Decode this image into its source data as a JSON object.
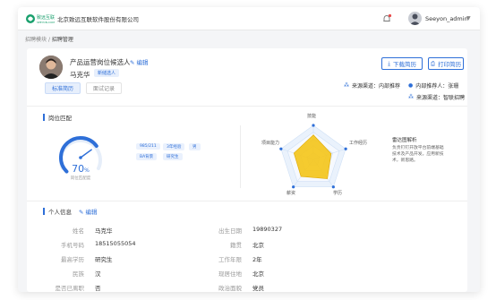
{
  "header": {
    "logo_text": "致远互联",
    "logo_subtext": "SEEYON.COM",
    "company": "北京致远互联软件股份有限公司",
    "username": "Seeyon_admin"
  },
  "breadcrumb": {
    "parent": "招聘模块",
    "separator": "/",
    "current": "招聘管理"
  },
  "candidate": {
    "job_title": "产品运营岗位候选人",
    "edit_label": "编辑",
    "name": "马克华",
    "tag": "新储选人"
  },
  "actions": {
    "download_label": "下载简历",
    "print_label": "打印简历"
  },
  "sources": {
    "row1": [
      {
        "label": "来源渠道：内部推荐"
      },
      {
        "label": "内部推荐人：张珊"
      }
    ],
    "row2": [
      {
        "label": "来源渠道：智联招聘"
      }
    ]
  },
  "tabs": [
    {
      "label": "标准简历",
      "active": true
    },
    {
      "label": "面试记录",
      "active": false
    }
  ],
  "match": {
    "section_title": "岗位匹配",
    "percent": "70",
    "percent_unit": "%",
    "percent_value": 70,
    "percent_label": "岗位匹配度",
    "tags": [
      "985/211",
      "3年经验",
      "男",
      "BA背景",
      "研究生"
    ]
  },
  "radar": {
    "labels": [
      "技能",
      "工作经历",
      "学历",
      "薪资",
      "项目能力"
    ],
    "values": [
      0.72,
      0.55,
      0.7,
      0.62,
      0.6
    ],
    "fill_color": "#f5c518",
    "grid_color": "#cfe0f5"
  },
  "analysis": {
    "title": "雷达图解析",
    "text": "负责钉钉开放平台前端基础技术及产品开发。应用新技术，新思路。"
  },
  "personal": {
    "section_title": "个人信息",
    "edit_label": "编辑",
    "fields_left": [
      {
        "label": "姓名",
        "value": "马克华"
      },
      {
        "label": "手机号码",
        "value": "18515055054"
      },
      {
        "label": "最高学历",
        "value": "研究生"
      },
      {
        "label": "民族",
        "value": "汉"
      },
      {
        "label": "是否已离职",
        "value": "否"
      }
    ],
    "fields_right": [
      {
        "label": "出生日期",
        "value": "19890327"
      },
      {
        "label": "籍贯",
        "value": "北京"
      },
      {
        "label": "工作年限",
        "value": "2年"
      },
      {
        "label": "现居住地",
        "value": "北京"
      },
      {
        "label": "政治面貌",
        "value": "党员"
      }
    ]
  },
  "colors": {
    "accent": "#2e6fd8",
    "tag_bg": "#e7effc",
    "radar_fill": "#f5c518"
  }
}
